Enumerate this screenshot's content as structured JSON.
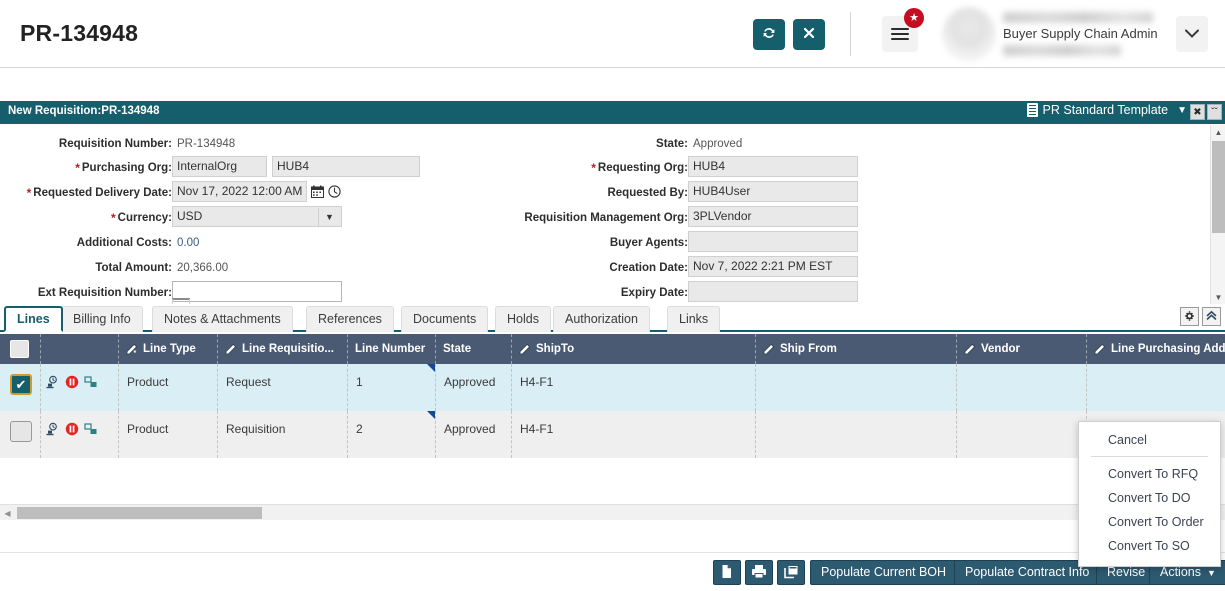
{
  "header": {
    "page_title": "PR-134948",
    "refresh_icon": "refresh-icon",
    "close_icon": "close-icon",
    "menu_icon": "hamburger-menu-icon",
    "badge_icon": "star-badge-icon",
    "user_role": "Buyer Supply Chain Admin",
    "user_caret_icon": "chevron-down-icon",
    "accent_color": "#155e6c",
    "badge_color": "#c40d20"
  },
  "panel": {
    "title": "New Requisition:PR-134948",
    "template_label": "PR Standard Template",
    "template_icon": "document-template-icon",
    "template_caret_icon": "caret-down-icon",
    "close_label": "✖",
    "collapse_label": "ˇˇ",
    "left_fields": [
      {
        "label": "Requisition Number:",
        "value": "PR-134948",
        "type": "text",
        "required": false
      },
      {
        "label": "Purchasing Org:",
        "value": "InternalOrg",
        "value2": "HUB4",
        "type": "input-pair",
        "required": true
      },
      {
        "label": "Requested Delivery Date:",
        "value": "Nov 17, 2022 12:00 AM",
        "type": "date",
        "required": true
      },
      {
        "label": "Currency:",
        "value": "USD",
        "type": "select",
        "required": true
      },
      {
        "label": "Additional Costs:",
        "value": "0.00",
        "type": "link",
        "required": false
      },
      {
        "label": "Total Amount:",
        "value": "20,366.00",
        "type": "text",
        "required": false
      },
      {
        "label": "Ext Requisition Number:",
        "value": "",
        "type": "input-white",
        "required": false
      }
    ],
    "right_fields": [
      {
        "label": "State:",
        "value": "Approved",
        "type": "text",
        "required": false
      },
      {
        "label": "Requesting Org:",
        "value": "HUB4",
        "type": "input",
        "required": true
      },
      {
        "label": "Requested By:",
        "value": "HUB4User",
        "type": "input",
        "required": false
      },
      {
        "label": "Requisition Management Org:",
        "value": "3PLVendor",
        "type": "input",
        "required": false
      },
      {
        "label": "Buyer Agents:",
        "value": "",
        "type": "input",
        "required": false
      },
      {
        "label": "Creation Date:",
        "value": "Nov 7, 2022 2:21 PM EST",
        "type": "input",
        "required": false
      },
      {
        "label": "Expiry Date:",
        "value": "",
        "type": "input",
        "required": false
      }
    ]
  },
  "tabs": [
    {
      "label": "Lines",
      "active": true
    },
    {
      "label": "Billing Info",
      "active": false
    },
    {
      "label": "Notes & Attachments",
      "active": false
    },
    {
      "label": "References",
      "active": false
    },
    {
      "label": "Documents",
      "active": false
    },
    {
      "label": "Holds",
      "active": false
    },
    {
      "label": "Authorization",
      "active": false
    },
    {
      "label": "Links",
      "active": false
    }
  ],
  "tab_tools": {
    "settings_icon": "gear-settings-icon",
    "collapse_icon": "collapse-up-icon"
  },
  "grid": {
    "columns": [
      {
        "label": "",
        "editable": false
      },
      {
        "label": "",
        "editable": false
      },
      {
        "label": "Line Type",
        "editable": true
      },
      {
        "label": "Line Requisitio...",
        "editable": true
      },
      {
        "label": "Line Number",
        "editable": false
      },
      {
        "label": "State",
        "editable": false
      },
      {
        "label": "ShipTo",
        "editable": true
      },
      {
        "label": "Ship From",
        "editable": true
      },
      {
        "label": "Vendor",
        "editable": true
      },
      {
        "label": "Line Purchasing Add",
        "editable": true
      }
    ],
    "rows": [
      {
        "selected": true,
        "line_type": "Product",
        "line_requisition": "Request",
        "line_number": "1",
        "state": "Approved",
        "ship_to": "H4-F1",
        "ship_from": "",
        "vendor": "",
        "line_purchasing_address": ""
      },
      {
        "selected": false,
        "line_type": "Product",
        "line_requisition": "Requisition",
        "line_number": "2",
        "state": "Approved",
        "ship_to": "H4-F1",
        "ship_from": "",
        "vendor": "",
        "line_purchasing_address": ""
      }
    ],
    "row_icons": [
      "history-stamp-icon",
      "hold-stop-icon",
      "hierarchy-icon"
    ],
    "header_bg": "#4a5a72",
    "selected_row_bg": "#daeef5"
  },
  "actions_menu": {
    "items": [
      {
        "label": "Cancel",
        "divider_after": true
      },
      {
        "label": "Convert To RFQ",
        "divider_after": false
      },
      {
        "label": "Convert To DO",
        "divider_after": false
      },
      {
        "label": "Convert To Order",
        "divider_after": false
      },
      {
        "label": "Convert To SO",
        "divider_after": false
      }
    ]
  },
  "bottom_bar": {
    "copy_icon": "copy-document-icon",
    "print_icon": "print-icon",
    "duplicate_icon": "duplicate-window-icon",
    "populate_boh": "Populate Current BOH",
    "populate_contract": "Populate Contract Info",
    "revise": "Revise",
    "actions": "Actions",
    "actions_caret_icon": "caret-down-icon"
  }
}
